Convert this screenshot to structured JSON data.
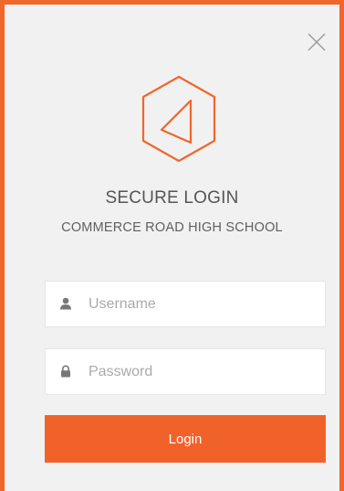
{
  "header": {
    "title": "SECURE LOGIN",
    "subtitle": "COMMERCE ROAD HIGH SCHOOL"
  },
  "icons": {
    "close": "close-icon",
    "logo": "hexagon-logo",
    "username": "user-icon",
    "password": "lock-icon"
  },
  "form": {
    "username_placeholder": "Username",
    "password_placeholder": "Password",
    "login_label": "Login"
  },
  "colors": {
    "accent": "#f0622a",
    "border": "#f0672b",
    "background": "#f1f1f1"
  }
}
